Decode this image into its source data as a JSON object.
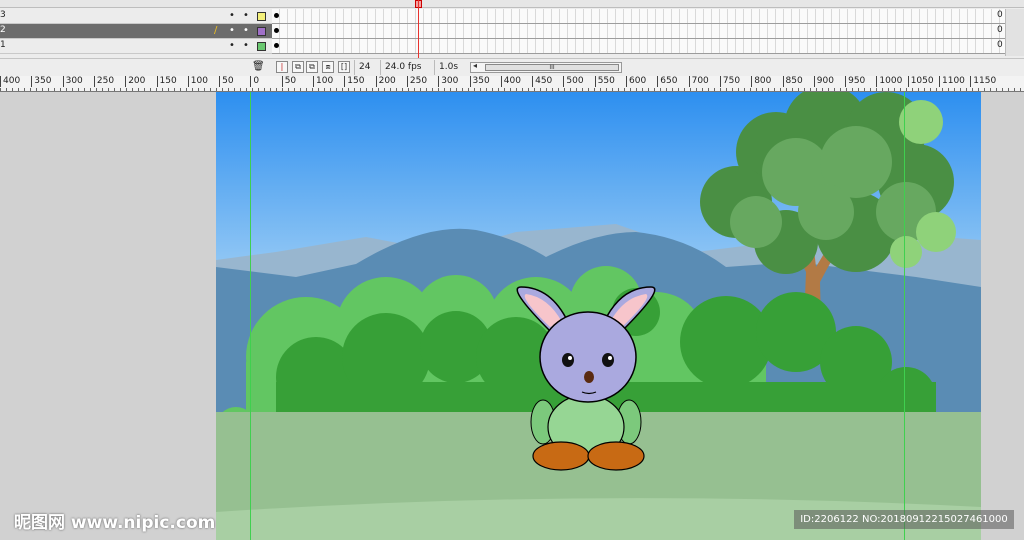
{
  "timeline": {
    "layers": [
      {
        "name": "3",
        "selected": false,
        "color": "#f4f07a"
      },
      {
        "name": "2",
        "selected": true,
        "color": "#a070c8"
      },
      {
        "name": "1",
        "selected": false,
        "color": "#6ac870"
      }
    ],
    "frame_end_label": "0",
    "current_frame": "24",
    "fps": "24.0 fps",
    "elapsed": "1.0s",
    "scroll_thumb": "III"
  },
  "ruler": {
    "labels": [
      "400",
      "350",
      "300",
      "250",
      "200",
      "150",
      "100",
      "50",
      "0",
      "50",
      "100",
      "150",
      "200",
      "250",
      "300",
      "350",
      "400",
      "450",
      "500",
      "550",
      "600",
      "650",
      "700",
      "750",
      "800",
      "850",
      "900",
      "950",
      "1000",
      "1050",
      "1100",
      "1150"
    ]
  },
  "icons": {
    "trash": "trash-icon",
    "onion": "onion-skin-icon",
    "center": "center-frame-icon"
  },
  "colors": {
    "playhead": "#e8322e",
    "guide": "#3fd04f",
    "selected_layer": "#6c6c6c"
  },
  "watermark": {
    "logo": "昵图网 www.nipic.com",
    "id": "ID:2206122 NO:20180912215027461000"
  }
}
